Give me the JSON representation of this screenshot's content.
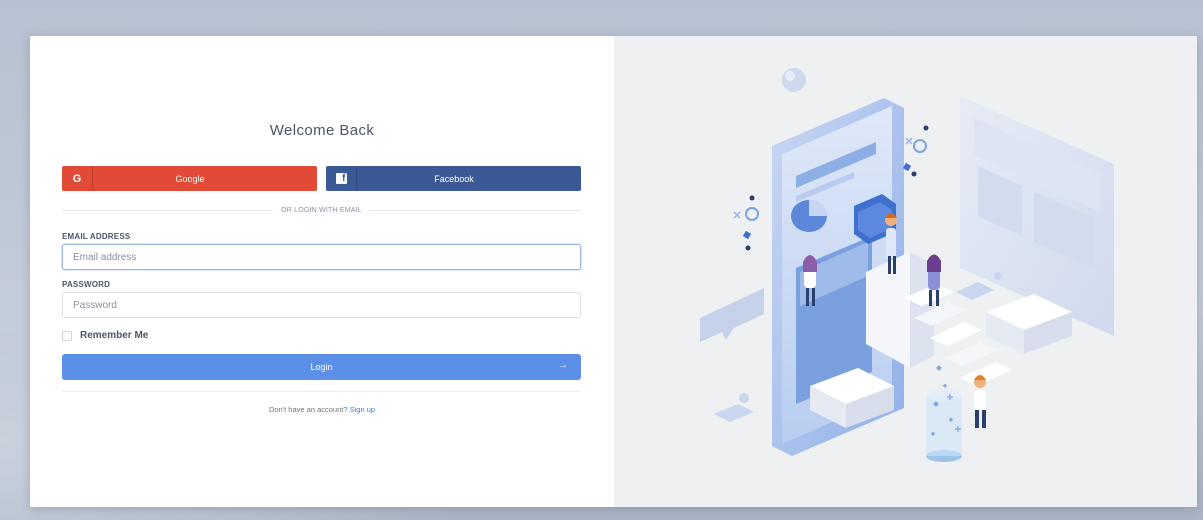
{
  "login": {
    "title": "Welcome Back",
    "google_label": "Google",
    "google_icon": "G",
    "facebook_label": "Facebook",
    "facebook_icon": "f",
    "divider_text": "OR LOGIN WITH EMAIL",
    "email_label": "EMAIL ADDRESS",
    "email_placeholder": "Email address",
    "email_value": "",
    "password_label": "PASSWORD",
    "password_placeholder": "Password",
    "password_value": "",
    "remember_label": "Remember Me",
    "remember_checked": false,
    "login_label": "Login",
    "login_arrow": "→",
    "signup_prompt": "Don't have an account?",
    "signup_link": "Sign up"
  },
  "colors": {
    "google": "#e04a36",
    "facebook": "#3b5997",
    "primary": "#5b8fe8",
    "link": "#3b7ddd",
    "illustration_bg": "#eef0f2"
  },
  "illustration": {
    "icon": "isometric-mobile-app-illustration"
  }
}
